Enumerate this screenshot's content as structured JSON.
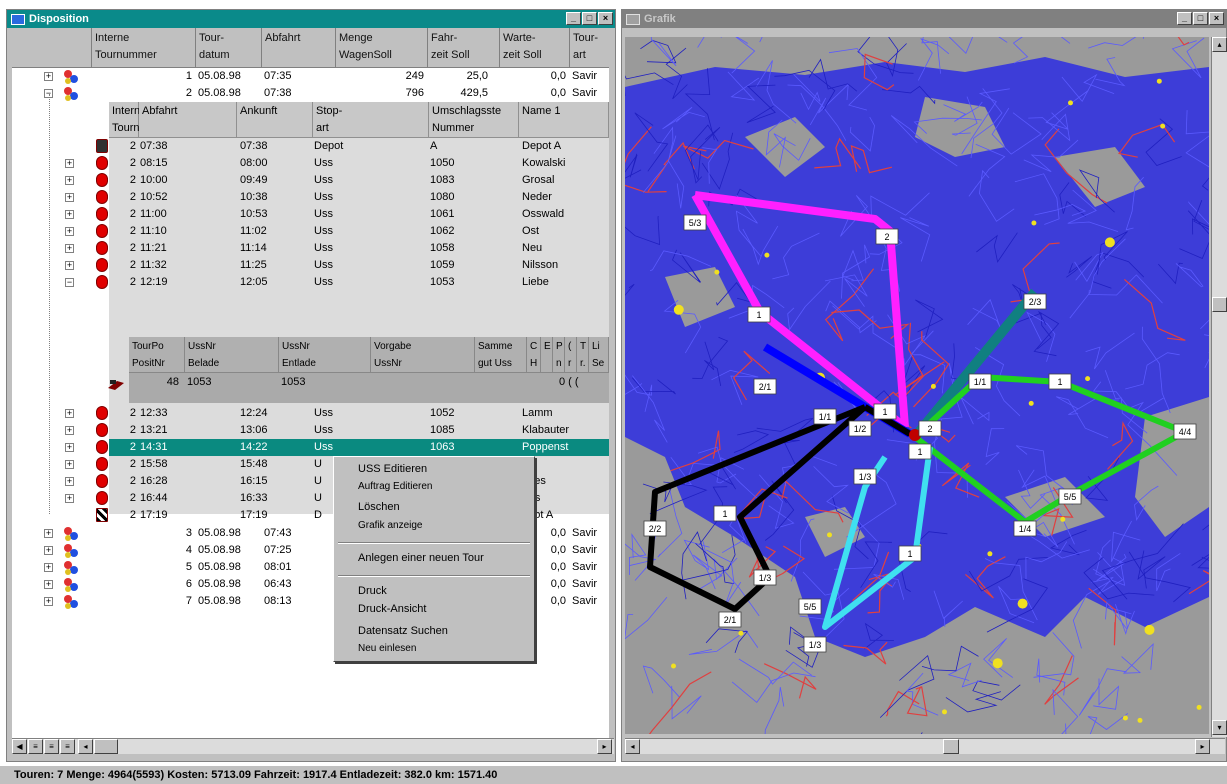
{
  "disposition": {
    "title": "Disposition",
    "columns": [
      "Interne\nTournummer",
      "Tour-\ndatum",
      "Abfahrt",
      "Menge\nWagenSoll",
      "Fahr-\nzeit Soll",
      "Warte-\nzeit Soll",
      "Tour-\nart"
    ],
    "top_tours": [
      {
        "nr": "1",
        "datum": "05.08.98",
        "abfahrt": "07:35",
        "menge": "249",
        "fahrzeit": "25,0",
        "wartezeit": "0,0",
        "art": "Savir"
      },
      {
        "nr": "2",
        "datum": "05.08.98",
        "abfahrt": "07:38",
        "menge": "796",
        "fahrzeit": "429,5",
        "wartezeit": "0,0",
        "art": "Savir"
      }
    ],
    "stops_columns": [
      "Interne\nTournur",
      "Abfahrt",
      "Ankunft",
      "Stop-\nart",
      "Umschlagsste\nNummer",
      "Name 1"
    ],
    "stops": [
      {
        "tour": "2",
        "abfahrt": "07:38",
        "ankunft": "07:38",
        "art": "Depot",
        "nummer": "A",
        "name": "Depot A"
      },
      {
        "tour": "2",
        "abfahrt": "08:15",
        "ankunft": "08:00",
        "art": "Uss",
        "nummer": "1050",
        "name": "Kowalski"
      },
      {
        "tour": "2",
        "abfahrt": "10:00",
        "ankunft": "09:49",
        "art": "Uss",
        "nummer": "1083",
        "name": "Grosal"
      },
      {
        "tour": "2",
        "abfahrt": "10:52",
        "ankunft": "10:38",
        "art": "Uss",
        "nummer": "1080",
        "name": "Neder"
      },
      {
        "tour": "2",
        "abfahrt": "11:00",
        "ankunft": "10:53",
        "art": "Uss",
        "nummer": "1061",
        "name": "Osswald"
      },
      {
        "tour": "2",
        "abfahrt": "11:10",
        "ankunft": "11:02",
        "art": "Uss",
        "nummer": "1062",
        "name": "Ost"
      },
      {
        "tour": "2",
        "abfahrt": "11:21",
        "ankunft": "11:14",
        "art": "Uss",
        "nummer": "1058",
        "name": "Neu"
      },
      {
        "tour": "2",
        "abfahrt": "11:32",
        "ankunft": "11:25",
        "art": "Uss",
        "nummer": "1059",
        "name": "Nilsson"
      },
      {
        "tour": "2",
        "abfahrt": "12:19",
        "ankunft": "12:05",
        "art": "Uss",
        "nummer": "1053",
        "name": "Liebe"
      }
    ],
    "sub2_columns": [
      "TourPo\nPositNr",
      "UssNr\nBelade",
      "UssNr\nEntlade",
      "Vorgabe\nUssNr",
      "Samme\ngut Uss",
      "C\nH",
      "E\n",
      "P\nn",
      "(\nr",
      "T\nr.",
      "Li\nSe"
    ],
    "sub2_row": {
      "pos": "48",
      "belade": "1053",
      "entlade": "1053",
      "tail": "0 ( ("
    },
    "stops_after": [
      {
        "tour": "2",
        "abfahrt": "12:33",
        "ankunft": "12:24",
        "art": "Uss",
        "nummer": "1052",
        "name": "Lamm"
      },
      {
        "tour": "2",
        "abfahrt": "13:21",
        "ankunft": "13:06",
        "art": "Uss",
        "nummer": "1085",
        "name": "Klabauter"
      },
      {
        "tour": "2",
        "abfahrt": "14:31",
        "ankunft": "14:22",
        "art": "Uss",
        "nummer": "1063",
        "name": "Poppenst"
      },
      {
        "tour": "2",
        "abfahrt": "15:58",
        "ankunft": "15:48",
        "art": "U",
        "nummer": "",
        "name": "roll"
      },
      {
        "tour": "2",
        "abfahrt": "16:28",
        "ankunft": "16:15",
        "art": "U",
        "nummer": "",
        "name": "anes"
      },
      {
        "tour": "2",
        "abfahrt": "16:44",
        "ankunft": "16:33",
        "art": "U",
        "nummer": "",
        "name": "Ves"
      },
      {
        "tour": "2",
        "abfahrt": "17:19",
        "ankunft": "17:19",
        "art": "D",
        "nummer": "",
        "name": "epot A"
      }
    ],
    "bottom_tours": [
      {
        "nr": "3",
        "datum": "05.08.98",
        "abfahrt": "07:43",
        "wartezeit": "0,0",
        "art": "Savir"
      },
      {
        "nr": "4",
        "datum": "05.08.98",
        "abfahrt": "07:25",
        "wartezeit": "0,0",
        "art": "Savir"
      },
      {
        "nr": "5",
        "datum": "05.08.98",
        "abfahrt": "08:01",
        "wartezeit": "0,0",
        "art": "Savir"
      },
      {
        "nr": "6",
        "datum": "05.08.98",
        "abfahrt": "06:43",
        "wartezeit": "0,0",
        "art": "Savir"
      },
      {
        "nr": "7",
        "datum": "05.08.98",
        "abfahrt": "08:13",
        "wartezeit": "0,0",
        "art": "Savir"
      }
    ]
  },
  "context_menu": {
    "items": [
      "USS Editieren",
      "Auftrag Editieren",
      "Löschen",
      "Grafik anzeige",
      "Anlegen einer neuen Tour",
      "Druck",
      "Druck-Ansicht",
      "Datensatz Suchen",
      "Neu einlesen"
    ]
  },
  "grafik": {
    "title": "Grafik",
    "labels": [
      "5/3",
      "2",
      "1",
      "2/1",
      "1/1",
      "1/2",
      "1",
      "2",
      "1",
      "4/4",
      "2/3",
      "1/1",
      "1",
      "2/2",
      "1",
      "1/3",
      "2/1",
      "5/5",
      "1",
      "1/3",
      "1/4",
      "5/5",
      "1/3"
    ],
    "route_colors": {
      "magenta": "#ff20ff",
      "teal": "#108080",
      "blue": "#0000ff",
      "black": "#000000",
      "green": "#20d020",
      "cyan": "#40e0f0",
      "land": "#9a9a9a",
      "roads": "#3030e0"
    }
  },
  "status_bar": {
    "text": "Touren: 7 Menge: 4964(5593) Kosten: 5713.09 Fahrzeit: 1917.4 Entladezeit: 382.0 km: 1571.40"
  }
}
